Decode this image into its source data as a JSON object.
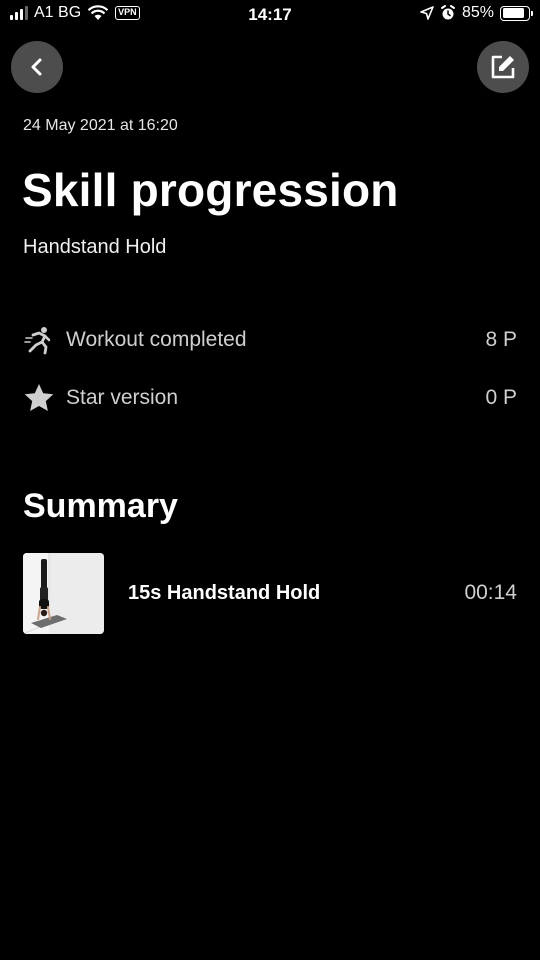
{
  "status_bar": {
    "carrier": "A1 BG",
    "vpn": "VPN",
    "time": "14:17",
    "battery": "85%",
    "battery_level": 0.85
  },
  "header": {
    "back_icon": "chevron-left-icon",
    "edit_icon": "edit-icon"
  },
  "session": {
    "date": "24 May 2021 at 16:20",
    "title": "Skill progression",
    "subtitle": "Handstand Hold"
  },
  "points": [
    {
      "icon": "running-person-icon",
      "label": "Workout completed",
      "value": "8 P"
    },
    {
      "icon": "star-icon",
      "label": "Star version",
      "value": "0 P"
    }
  ],
  "summary": {
    "title": "Summary",
    "items": [
      {
        "name": "15s Handstand Hold",
        "time": "00:14",
        "thumbnail": "handstand-photo"
      }
    ]
  },
  "colors": {
    "background": "#000000",
    "text_primary": "#ffffff",
    "text_secondary": "#cfcfcf",
    "button_bg": "#4d4d4d"
  }
}
